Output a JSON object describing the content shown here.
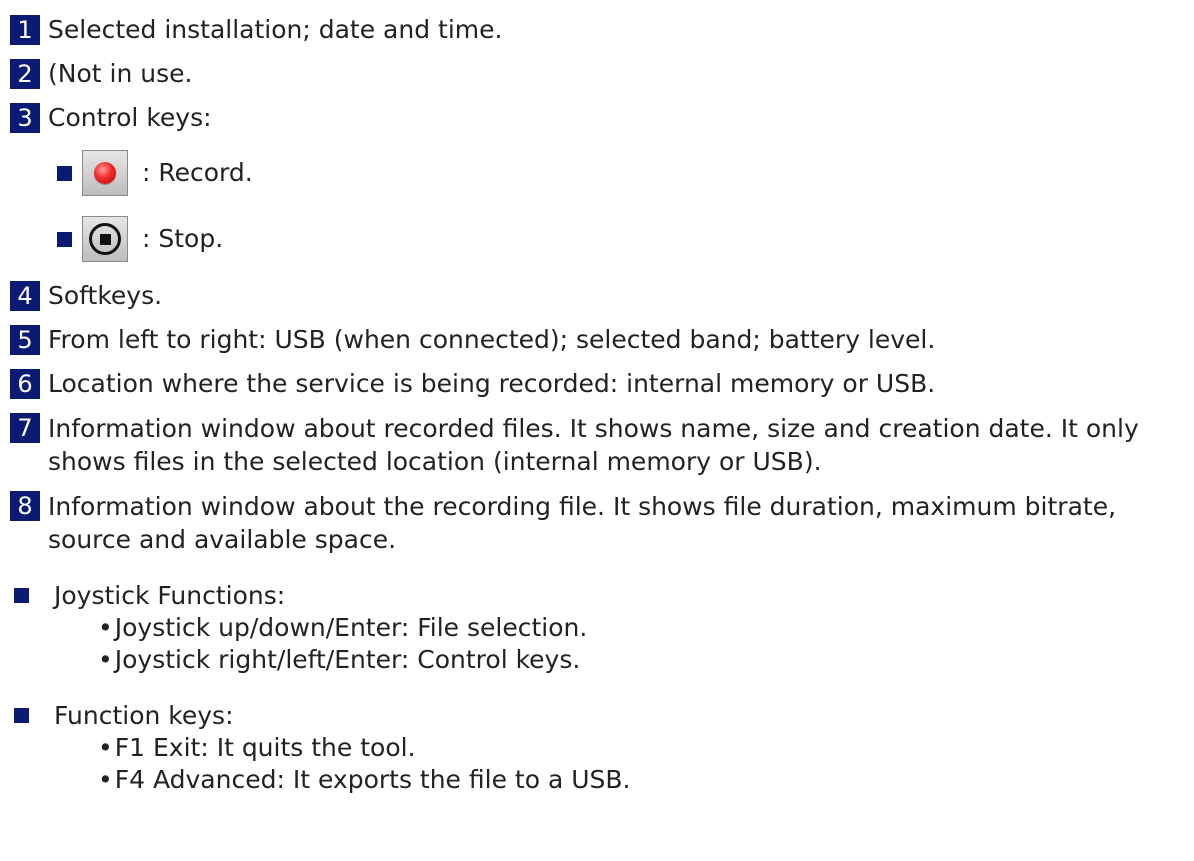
{
  "items": [
    {
      "num": "1",
      "text": "Selected installation; date and time."
    },
    {
      "num": "2",
      "text": "(Not in use."
    },
    {
      "num": "3",
      "text": "Control keys:"
    },
    {
      "num": "4",
      "text": "Softkeys."
    },
    {
      "num": "5",
      "text": "From left to right: USB (when connected); selected band; battery level."
    },
    {
      "num": "6",
      "text": "Location where the service is being recorded: internal memory or USB."
    },
    {
      "num": "7",
      "text": "Information window about recorded files. It shows name, size and creation date. It only shows files in the selected location (internal memory or USB)."
    },
    {
      "num": "8",
      "text": "Information window about the recording file. It shows file duration, maximum bitrate, source and available space."
    }
  ],
  "control_keys": [
    {
      "icon": "record-icon",
      "label": ": Record."
    },
    {
      "icon": "stop-icon",
      "label": ": Stop."
    }
  ],
  "joystick": {
    "title": "Joystick Functions:",
    "lines": [
      "Joystick up/down/Enter: File selection.",
      "Joystick right/left/Enter: Control keys."
    ]
  },
  "function_keys": {
    "title": "Function keys:",
    "lines": [
      "F1 Exit: It quits the tool.",
      "F4 Advanced: It exports the file to a USB."
    ]
  },
  "bullet_char": "•",
  "colors": {
    "badge": "#0b1a73",
    "text": "#222222",
    "record": "#f22a2a"
  }
}
